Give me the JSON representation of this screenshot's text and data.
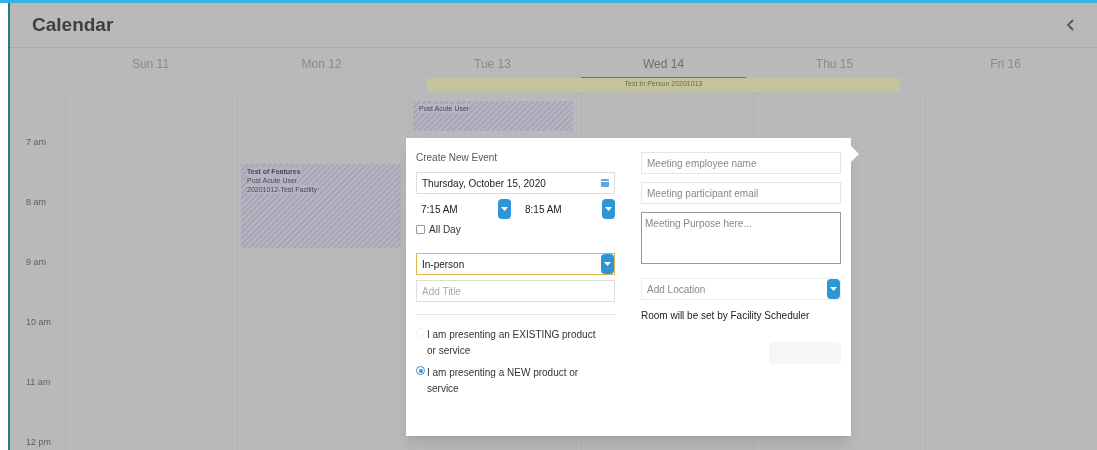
{
  "header": {
    "title": "Calendar"
  },
  "days": [
    {
      "label": "Sun 11",
      "selected": false
    },
    {
      "label": "Mon 12",
      "selected": false
    },
    {
      "label": "Tue 13",
      "selected": false
    },
    {
      "label": "Wed 14",
      "selected": true
    },
    {
      "label": "Thu 15",
      "selected": false
    },
    {
      "label": "Fri 16",
      "selected": false
    }
  ],
  "all_day_events": [
    {
      "title": "Test In Person 20201013"
    }
  ],
  "times": [
    "7 am",
    "8 am",
    "9 am",
    "10 am",
    "11 am",
    "12 pm"
  ],
  "events": [
    {
      "lines": [
        "Post Acute User"
      ]
    },
    {
      "lines": [
        "Test of Features",
        "Post Acute User",
        "20201012-Test Facility"
      ]
    }
  ],
  "dialog": {
    "title": "Create New Event",
    "date": "Thursday, October 15, 2020",
    "start_time": "7:15 AM",
    "end_time": "8:15 AM",
    "all_day": {
      "label": "All Day",
      "checked": false
    },
    "meeting_type": "In-person",
    "title_placeholder": "Add Title",
    "presenting": [
      {
        "label": "I am presenting an EXISTING product or service",
        "selected": false
      },
      {
        "label": "I am presenting a NEW product or service",
        "selected": true
      }
    ],
    "employee_placeholder": "Meeting employee name",
    "email_placeholder": "Meeting participant email",
    "purpose_placeholder": "Meeting Purpose here...",
    "location_placeholder": "Add Location",
    "room_note": "Room will be set by Facility Scheduler"
  }
}
